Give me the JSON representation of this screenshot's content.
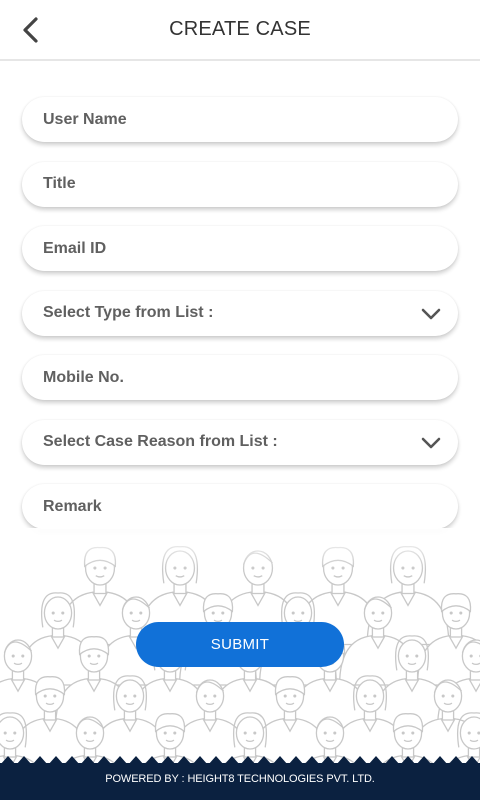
{
  "header": {
    "title": "CREATE CASE",
    "back_icon": "chevron-left-icon"
  },
  "form": {
    "user_name_placeholder": "User Name",
    "title_placeholder": "Title",
    "email_placeholder": "Email ID",
    "type_select_label": "Select Type from List :",
    "mobile_placeholder": "Mobile No.",
    "reason_select_label": "Select Case Reason from List :",
    "remark_placeholder": "Remark"
  },
  "submit_label": "SUBMIT",
  "footer": {
    "text": "POWERED BY : HEIGHT8 TECHNOLOGIES PVT. LTD."
  },
  "colors": {
    "accent": "#1171d8",
    "footer_bg": "#0b2140",
    "crowd_stroke": "#c8c8c8"
  }
}
